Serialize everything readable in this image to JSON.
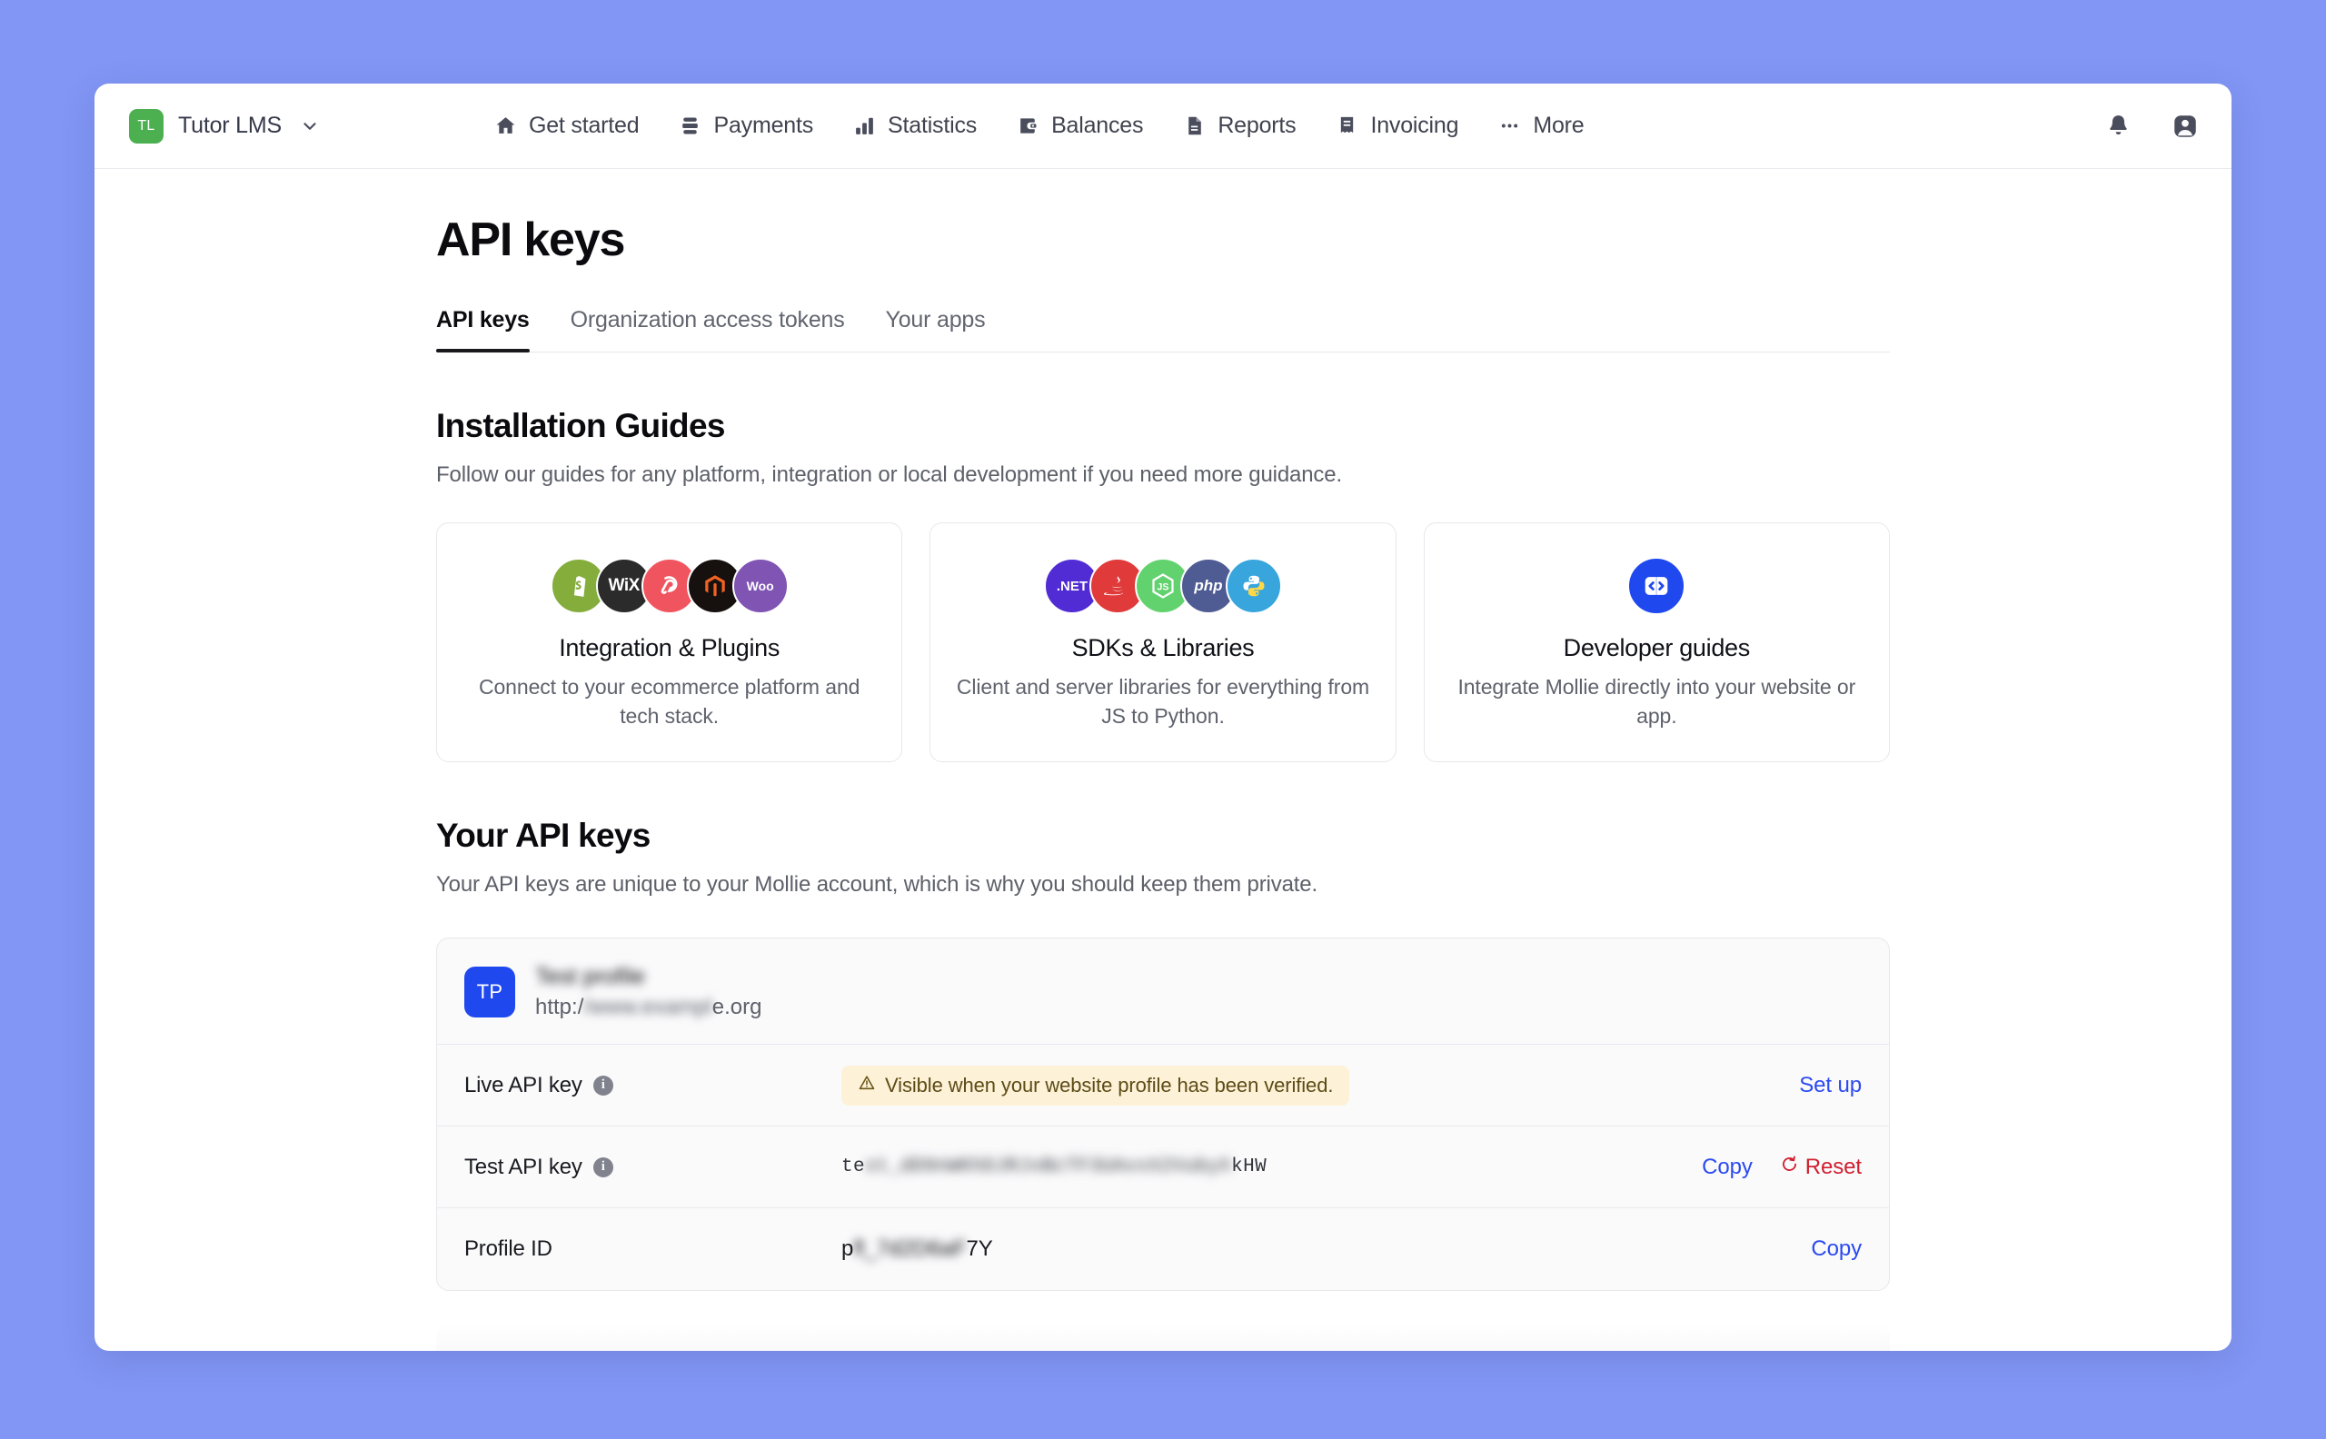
{
  "topbar": {
    "brand": {
      "initials": "TL",
      "name": "Tutor LMS",
      "caret_icon": "chevron-down-icon"
    },
    "nav": [
      {
        "label": "Get started",
        "icon": "home-icon"
      },
      {
        "label": "Payments",
        "icon": "payments-icon"
      },
      {
        "label": "Statistics",
        "icon": "bar-chart-icon"
      },
      {
        "label": "Balances",
        "icon": "wallet-icon"
      },
      {
        "label": "Reports",
        "icon": "document-icon"
      },
      {
        "label": "Invoicing",
        "icon": "receipt-icon"
      },
      {
        "label": "More",
        "icon": "ellipsis-icon"
      }
    ],
    "notifications_icon": "bell-icon",
    "account_icon": "user-avatar-icon"
  },
  "page": {
    "title": "API keys",
    "tabs": [
      {
        "label": "API keys",
        "active": true
      },
      {
        "label": "Organization access tokens",
        "active": false
      },
      {
        "label": "Your apps",
        "active": false
      }
    ]
  },
  "installation": {
    "title": "Installation Guides",
    "subtitle": "Follow our guides for any platform, integration or local development if you need more guidance.",
    "cards": [
      {
        "title": "Integration & Plugins",
        "description": "Connect to your ecommerce platform and tech stack.",
        "logos": [
          {
            "name": "shopify-logo",
            "label": "S",
            "color": "#84ad3c"
          },
          {
            "name": "wix-logo",
            "label": "WiX",
            "color": "#2b2b2b"
          },
          {
            "name": "lightspeed-logo",
            "label": "",
            "color": "#f0555f"
          },
          {
            "name": "magento-logo",
            "label": "",
            "color": "#16100f"
          },
          {
            "name": "woocommerce-logo",
            "label": "Woo",
            "color": "#7f54b3"
          }
        ]
      },
      {
        "title": "SDKs & Libraries",
        "description": "Client and server libraries for everything from JS to Python.",
        "logos": [
          {
            "name": "dotnet-logo",
            "label": ".NET",
            "color": "#512bd4"
          },
          {
            "name": "java-logo",
            "label": "",
            "color": "#e03a3a"
          },
          {
            "name": "nodejs-logo",
            "label": "JS",
            "color": "#62d26f"
          },
          {
            "name": "php-logo",
            "label": "php",
            "color": "#4f5b93"
          },
          {
            "name": "python-logo",
            "label": "",
            "color": "#38a5dd"
          }
        ]
      },
      {
        "title": "Developer guides",
        "description": "Integrate Mollie directly into your website or app.",
        "logos": [
          {
            "name": "code-brackets-logo",
            "label": "",
            "color": "#1f49ee"
          }
        ]
      }
    ]
  },
  "your_api_keys": {
    "title": "Your API keys",
    "subtitle": "Your API keys are unique to your Mollie account, which is why you should keep them private.",
    "profile": {
      "avatar_initials": "TP",
      "name": "Test profile",
      "url_prefix": "http:/",
      "url_masked": "/www.exampl",
      "url_suffix": "e.org"
    },
    "rows": [
      {
        "label": "Live API key",
        "info_icon": "info-icon",
        "value_type": "warning",
        "warning_icon": "warning-triangle-icon",
        "warning_text": "Visible when your website profile has been verified.",
        "actions": [
          {
            "label": "Set up",
            "style": "link",
            "name": "set-up-link"
          }
        ]
      },
      {
        "label": "Test API key",
        "info_icon": "info-icon",
        "value_type": "secret",
        "secret_prefix": "te",
        "secret_masked": "st_dD9nWKhDJRJvBcTF3UAvxX2VubyX",
        "secret_suffix": "kHW",
        "actions": [
          {
            "label": "Copy",
            "style": "link",
            "name": "copy-test-key-link"
          },
          {
            "label": "Reset",
            "style": "danger",
            "icon": "reset-icon",
            "name": "reset-test-key-link"
          }
        ]
      },
      {
        "label": "Profile ID",
        "value_type": "id",
        "id_prefix": "p",
        "id_masked": "fl_7d2D6aF",
        "id_suffix": "7Y",
        "actions": [
          {
            "label": "Copy",
            "style": "link",
            "name": "copy-profile-id-link"
          }
        ]
      }
    ]
  },
  "colors": {
    "page_background": "#8296f5",
    "brand_green": "#4caf50",
    "link_blue": "#2b4af0",
    "danger_red": "#d02030",
    "warning_bg": "#fdf2d7",
    "avatar_blue": "#1f49ee"
  }
}
